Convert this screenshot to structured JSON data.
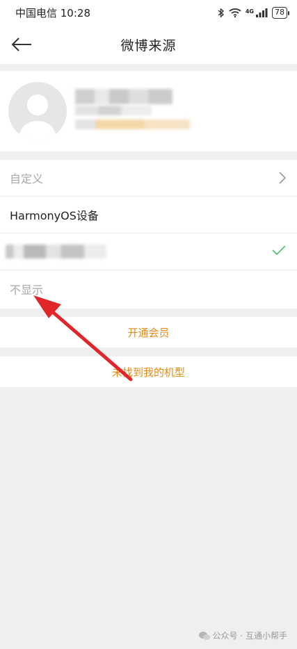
{
  "status_bar": {
    "carrier_time": "中国电信 10:28",
    "network": "4G",
    "battery": "78"
  },
  "header": {
    "title": "微博来源",
    "back_icon": "arrow-left-icon"
  },
  "options": {
    "custom_label": "自定义",
    "harmony_label": "HarmonyOS设备",
    "hidden_label": "不显示"
  },
  "buttons": {
    "vip": "开通会员",
    "missing_model": "未找到我的机型"
  },
  "watermark": "公众号 · 互通小帮手",
  "colors": {
    "accent": "#e48a12",
    "check": "#4cbf6b",
    "annotation_arrow": "#e0262b"
  }
}
